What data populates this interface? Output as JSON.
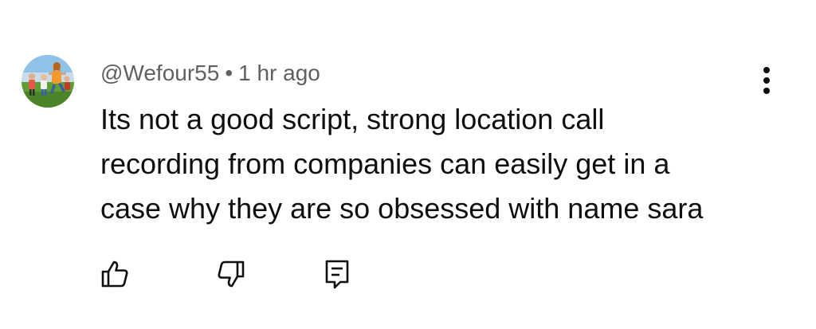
{
  "comment": {
    "author": "@Wefour55",
    "separator": "•",
    "time": "1 hr ago",
    "text_lines": [
      "Its not a good script, strong location call",
      "recording from companies can easily get in a",
      "case why they are so obsessed with name sara"
    ]
  },
  "icons": {
    "avatar": "avatar-photo",
    "menu": "more-vert-icon",
    "like": "thumbs-up-icon",
    "dislike": "thumbs-down-icon",
    "reply": "reply-comment-icon"
  },
  "colors": {
    "text": "#0f0f0f",
    "meta": "#606060",
    "background": "#ffffff"
  }
}
